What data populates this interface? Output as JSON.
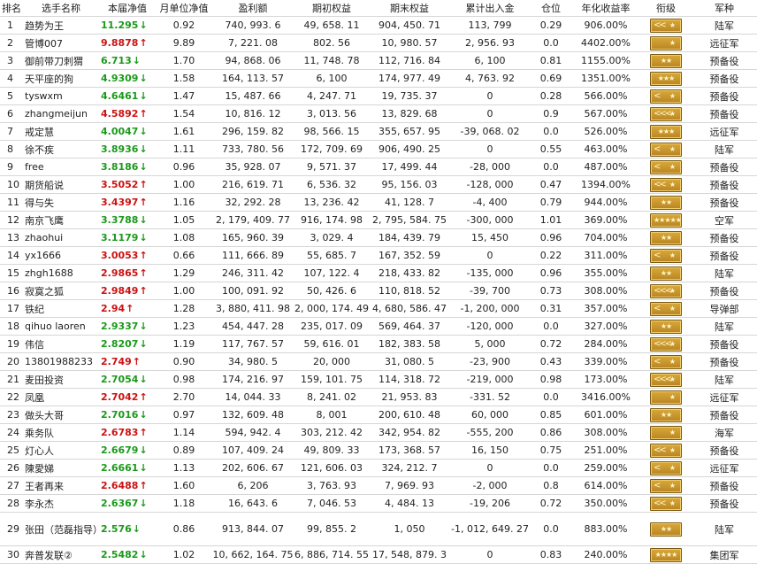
{
  "headers": [
    "排名",
    "选手名称",
    "本届净值",
    "月单位净值",
    "盈利额",
    "期初权益",
    "期末权益",
    "累计出入金",
    "仓位",
    "年化收益率",
    "衔级",
    "军种"
  ],
  "colors": {
    "up": "#cc1111",
    "down": "#1a9a1a",
    "badge": "#c8962e"
  },
  "rows": [
    {
      "rank": "1",
      "name": "趋势为王",
      "nav": "11.295",
      "dir": "down",
      "month": "0.92",
      "profit": "740, 993. 6",
      "start": "49, 658. 11",
      "end": "904, 450. 71",
      "flow": "113, 799",
      "pos": "0.29",
      "annual": "906.00%",
      "badge": "chev2",
      "army": "陆军"
    },
    {
      "rank": "2",
      "name": "管博007",
      "nav": "9.8878",
      "dir": "up",
      "month": "9.89",
      "profit": "7, 221. 08",
      "start": "802. 56",
      "end": "10, 980. 57",
      "flow": "2, 956. 93",
      "pos": "0.0",
      "annual": "4402.00%",
      "badge": "bar1",
      "army": "远征军"
    },
    {
      "rank": "3",
      "name": "御前带刀刺猬",
      "nav": "6.713",
      "dir": "down",
      "month": "1.70",
      "profit": "94, 868. 06",
      "start": "11, 748. 78",
      "end": "112, 716. 84",
      "flow": "6, 100",
      "pos": "0.81",
      "annual": "1155.00%",
      "badge": "star2",
      "army": "预备役"
    },
    {
      "rank": "4",
      "name": "天平座的狗",
      "nav": "4.9309",
      "dir": "down",
      "month": "1.58",
      "profit": "164, 113. 57",
      "start": "6, 100",
      "end": "174, 977. 49",
      "flow": "4, 763. 92",
      "pos": "0.69",
      "annual": "1351.00%",
      "badge": "star3",
      "army": "预备役"
    },
    {
      "rank": "5",
      "name": "tyswxm",
      "nav": "4.6461",
      "dir": "down",
      "month": "1.47",
      "profit": "15, 487. 66",
      "start": "4, 247. 71",
      "end": "19, 735. 37",
      "flow": "0",
      "pos": "0.28",
      "annual": "566.00%",
      "badge": "chev1",
      "army": "预备役"
    },
    {
      "rank": "6",
      "name": "zhangmeijun",
      "nav": "4.5892",
      "dir": "up",
      "month": "1.54",
      "profit": "10, 816. 12",
      "start": "3, 013. 56",
      "end": "13, 829. 68",
      "flow": "0",
      "pos": "0.9",
      "annual": "567.00%",
      "badge": "chev3dot",
      "army": "预备役"
    },
    {
      "rank": "7",
      "name": "戒定慧",
      "nav": "4.0047",
      "dir": "down",
      "month": "1.61",
      "profit": "296, 159. 82",
      "start": "98, 566. 15",
      "end": "355, 657. 95",
      "flow": "-39, 068. 02",
      "pos": "0.0",
      "annual": "526.00%",
      "badge": "star3",
      "army": "远征军"
    },
    {
      "rank": "8",
      "name": "徐不疾",
      "nav": "3.8936",
      "dir": "down",
      "month": "1.11",
      "profit": "733, 780. 56",
      "start": "172, 709. 69",
      "end": "906, 490. 25",
      "flow": "0",
      "pos": "0.55",
      "annual": "463.00%",
      "badge": "chev1",
      "army": "陆军"
    },
    {
      "rank": "9",
      "name": "free",
      "nav": "3.8186",
      "dir": "down",
      "month": "0.96",
      "profit": "35, 928. 07",
      "start": "9, 571. 37",
      "end": "17, 499. 44",
      "flow": "-28, 000",
      "pos": "0.0",
      "annual": "487.00%",
      "badge": "chev1",
      "army": "预备役"
    },
    {
      "rank": "10",
      "name": "期货船说",
      "nav": "3.5052",
      "dir": "up",
      "month": "1.00",
      "profit": "216, 619. 71",
      "start": "6, 536. 32",
      "end": "95, 156. 03",
      "flow": "-128, 000",
      "pos": "0.47",
      "annual": "1394.00%",
      "badge": "chev2",
      "army": "预备役"
    },
    {
      "rank": "11",
      "name": "得与失",
      "nav": "3.4397",
      "dir": "up",
      "month": "1.16",
      "profit": "32, 292. 28",
      "start": "13, 236. 42",
      "end": "41, 128. 7",
      "flow": "-4, 400",
      "pos": "0.79",
      "annual": "944.00%",
      "badge": "star2",
      "army": "预备役"
    },
    {
      "rank": "12",
      "name": "南京飞鹰",
      "nav": "3.3788",
      "dir": "down",
      "month": "1.05",
      "profit": "2, 179, 409. 77",
      "start": "916, 174. 98",
      "end": "2, 795, 584. 75",
      "flow": "-300, 000",
      "pos": "1.01",
      "annual": "369.00%",
      "badge": "star5",
      "army": "空军"
    },
    {
      "rank": "13",
      "name": "zhaohui",
      "nav": "3.1179",
      "dir": "down",
      "month": "1.08",
      "profit": "165, 960. 39",
      "start": "3, 029. 4",
      "end": "184, 439. 79",
      "flow": "15, 450",
      "pos": "0.96",
      "annual": "704.00%",
      "badge": "star2",
      "army": "预备役"
    },
    {
      "rank": "14",
      "name": "yx1666",
      "nav": "3.0053",
      "dir": "up",
      "month": "0.66",
      "profit": "111, 666. 89",
      "start": "55, 685. 7",
      "end": "167, 352. 59",
      "flow": "0",
      "pos": "0.22",
      "annual": "311.00%",
      "badge": "chev1",
      "army": "预备役"
    },
    {
      "rank": "15",
      "name": "zhgh1688",
      "nav": "2.9865",
      "dir": "up",
      "month": "1.29",
      "profit": "246, 311. 42",
      "start": "107, 122. 4",
      "end": "218, 433. 82",
      "flow": "-135, 000",
      "pos": "0.96",
      "annual": "355.00%",
      "badge": "star2",
      "army": "陆军"
    },
    {
      "rank": "16",
      "name": "寂寞之狐",
      "nav": "2.9849",
      "dir": "up",
      "month": "1.00",
      "profit": "100, 091. 92",
      "start": "50, 426. 6",
      "end": "110, 818. 52",
      "flow": "-39, 700",
      "pos": "0.73",
      "annual": "308.00%",
      "badge": "chev3dot",
      "army": "预备役"
    },
    {
      "rank": "17",
      "name": "铁纪",
      "nav": "2.94",
      "dir": "up",
      "month": "1.28",
      "profit": "3, 880, 411. 98",
      "start": "2, 000, 174. 49",
      "end": "4, 680, 586. 47",
      "flow": "-1, 200, 000",
      "pos": "0.31",
      "annual": "357.00%",
      "badge": "chev1",
      "army": "导弹部"
    },
    {
      "rank": "18",
      "name": "qihuo laoren",
      "nav": "2.9337",
      "dir": "down",
      "month": "1.23",
      "profit": "454, 447. 28",
      "start": "235, 017. 09",
      "end": "569, 464. 37",
      "flow": "-120, 000",
      "pos": "0.0",
      "annual": "327.00%",
      "badge": "star2",
      "army": "陆军"
    },
    {
      "rank": "19",
      "name": "伟信",
      "nav": "2.8207",
      "dir": "down",
      "month": "1.19",
      "profit": "117, 767. 57",
      "start": "59, 616. 01",
      "end": "182, 383. 58",
      "flow": "5, 000",
      "pos": "0.72",
      "annual": "284.00%",
      "badge": "chev3dot",
      "army": "预备役"
    },
    {
      "rank": "20",
      "name": "13801988233",
      "nav": "2.749",
      "dir": "up",
      "month": "0.90",
      "profit": "34, 980. 5",
      "start": "20, 000",
      "end": "31, 080. 5",
      "flow": "-23, 900",
      "pos": "0.43",
      "annual": "339.00%",
      "badge": "chev1",
      "army": "预备役"
    },
    {
      "rank": "21",
      "name": "麦田投资",
      "nav": "2.7054",
      "dir": "down",
      "month": "0.98",
      "profit": "174, 216. 97",
      "start": "159, 101. 75",
      "end": "114, 318. 72",
      "flow": "-219, 000",
      "pos": "0.98",
      "annual": "173.00%",
      "badge": "chev3dot",
      "army": "陆军"
    },
    {
      "rank": "22",
      "name": "凤凰",
      "nav": "2.7042",
      "dir": "up",
      "month": "2.70",
      "profit": "14, 044. 33",
      "start": "8, 241. 02",
      "end": "21, 953. 83",
      "flow": "-331. 52",
      "pos": "0.0",
      "annual": "3416.00%",
      "badge": "bar1",
      "army": "远征军"
    },
    {
      "rank": "23",
      "name": "做头大哥",
      "nav": "2.7016",
      "dir": "down",
      "month": "0.97",
      "profit": "132, 609. 48",
      "start": "8, 001",
      "end": "200, 610. 48",
      "flow": "60, 000",
      "pos": "0.85",
      "annual": "601.00%",
      "badge": "star2",
      "army": "预备役"
    },
    {
      "rank": "24",
      "name": "乘务队",
      "nav": "2.6783",
      "dir": "up",
      "month": "1.14",
      "profit": "594, 942. 4",
      "start": "303, 212. 42",
      "end": "342, 954. 82",
      "flow": "-555, 200",
      "pos": "0.86",
      "annual": "308.00%",
      "badge": "bar1",
      "army": "海军"
    },
    {
      "rank": "25",
      "name": "灯心人",
      "nav": "2.6679",
      "dir": "down",
      "month": "0.89",
      "profit": "107, 409. 24",
      "start": "49, 809. 33",
      "end": "173, 368. 57",
      "flow": "16, 150",
      "pos": "0.75",
      "annual": "251.00%",
      "badge": "chev2",
      "army": "预备役"
    },
    {
      "rank": "26",
      "name": "陳愛娣",
      "nav": "2.6661",
      "dir": "down",
      "month": "1.13",
      "profit": "202, 606. 67",
      "start": "121, 606. 03",
      "end": "324, 212. 7",
      "flow": "0",
      "pos": "0.0",
      "annual": "259.00%",
      "badge": "chev1",
      "army": "远征军"
    },
    {
      "rank": "27",
      "name": "王者再来",
      "nav": "2.6488",
      "dir": "up",
      "month": "1.60",
      "profit": "6, 206",
      "start": "3, 763. 93",
      "end": "7, 969. 93",
      "flow": "-2, 000",
      "pos": "0.8",
      "annual": "614.00%",
      "badge": "chev1",
      "army": "预备役"
    },
    {
      "rank": "28",
      "name": "李永杰",
      "nav": "2.6367",
      "dir": "down",
      "month": "1.18",
      "profit": "16, 643. 6",
      "start": "7, 046. 53",
      "end": "4, 484. 13",
      "flow": "-19, 206",
      "pos": "0.72",
      "annual": "350.00%",
      "badge": "chev2",
      "army": "预备役"
    },
    {
      "rank": "29",
      "name": "张田（范磊指导）",
      "nav": "2.576",
      "dir": "down",
      "month": "0.86",
      "profit": "913, 844. 07",
      "start": "99, 855. 2",
      "end": "1, 050",
      "flow": "-1, 012, 649. 27",
      "pos": "0.0",
      "annual": "883.00%",
      "badge": "star2",
      "army": "陆军",
      "tall": true
    },
    {
      "rank": "30",
      "name": "奔普发联②",
      "nav": "2.5482",
      "dir": "down",
      "month": "1.02",
      "profit": "10, 662, 164. 75",
      "start": "6, 886, 714. 55",
      "end": "17, 548, 879. 3",
      "flow": "0",
      "pos": "0.83",
      "annual": "240.00%",
      "badge": "star4",
      "army": "集团军"
    }
  ]
}
